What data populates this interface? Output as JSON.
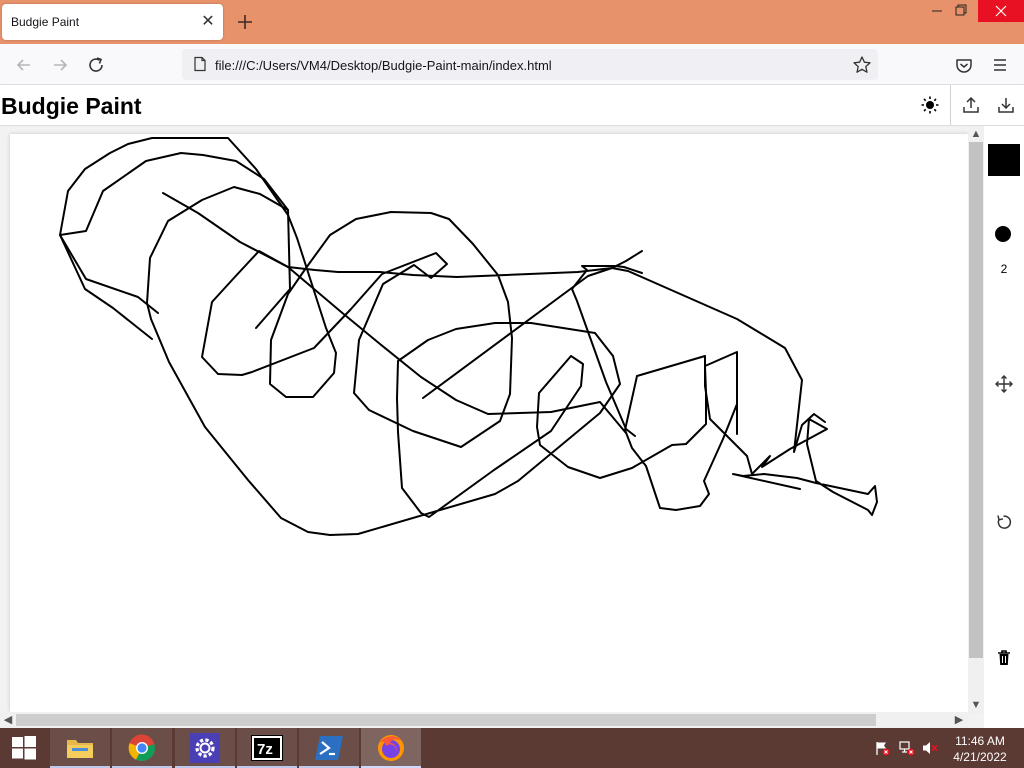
{
  "browser": {
    "tab_title": "Budgie Paint",
    "url": "file:///C:/Users/VM4/Desktop/Budgie-Paint-main/index.html"
  },
  "app": {
    "title": "Budgie Paint",
    "theme_icon": "sun-icon",
    "upload_icon": "upload-icon",
    "download_icon": "download-icon"
  },
  "tools": {
    "color": "#000000",
    "brush_size": "2",
    "icons": [
      "color-swatch",
      "brush-dot",
      "move-icon",
      "undo-icon",
      "trash-icon"
    ]
  },
  "taskbar": {
    "apps": [
      "start-icon",
      "file-explorer-icon",
      "chrome-icon",
      "settings-icon",
      "7zip-icon",
      "powershell-icon",
      "firefox-icon"
    ],
    "time": "11:46 AM",
    "date": "4/21/2022"
  },
  "colors": {
    "titlebar": "#e8926b",
    "taskbar": "#5a3a33",
    "stroke": "#000000"
  }
}
